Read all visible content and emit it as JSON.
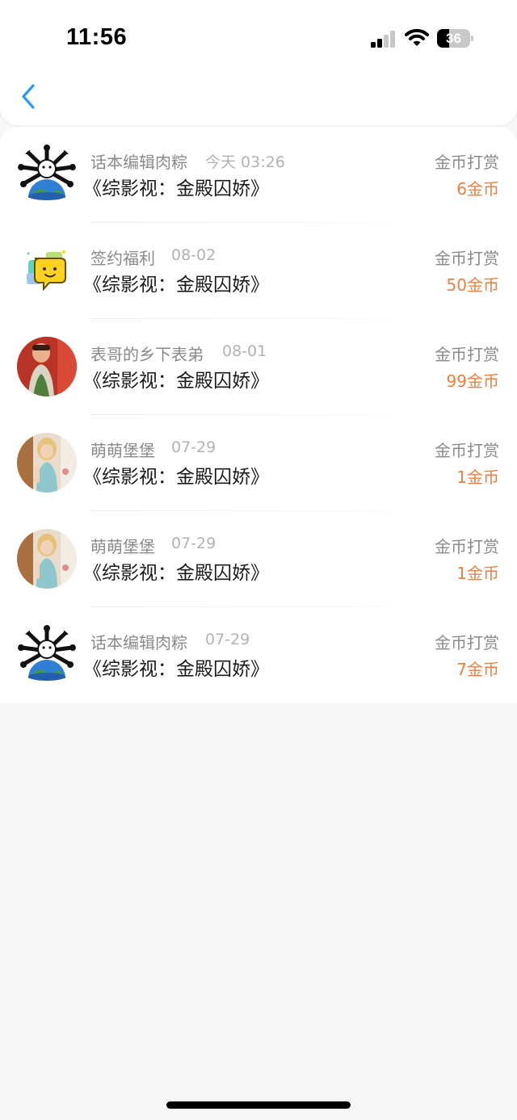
{
  "status_bar": {
    "time": "11:56",
    "battery": "36",
    "battery_fraction": 0.36,
    "signal_bars": 2,
    "icons": [
      "signal-icon",
      "wifi-icon",
      "battery-icon"
    ]
  },
  "nav": {
    "back_icon": "chevron-left-icon",
    "accent": "#2f9bf0"
  },
  "colors": {
    "amount": "#ec7f3f",
    "meta": "#8a8a8a",
    "date": "#b2b2b2"
  },
  "records": [
    {
      "sender": "话本编辑肉粽",
      "date": "今天 03:26",
      "book": "《综影视：金殿囚娇》",
      "type": "金币打赏",
      "amount": "6金币",
      "avatar": "earth-cartoon-avatar"
    },
    {
      "sender": "签约福利",
      "date": "08-02",
      "book": "《综影视：金殿囚娇》",
      "type": "金币打赏",
      "amount": "50金币",
      "avatar": "yellow-chat-bubble-avatar"
    },
    {
      "sender": "表哥的乡下表弟",
      "date": "08-01",
      "book": "《综影视：金殿囚娇》",
      "type": "金币打赏",
      "amount": "99金币",
      "avatar": "red-photo-avatar"
    },
    {
      "sender": "萌萌堡堡",
      "date": "07-29",
      "book": "《综影视：金殿囚娇》",
      "type": "金币打赏",
      "amount": "1金币",
      "avatar": "doll-photo-avatar"
    },
    {
      "sender": "萌萌堡堡",
      "date": "07-29",
      "book": "《综影视：金殿囚娇》",
      "type": "金币打赏",
      "amount": "1金币",
      "avatar": "doll-photo-avatar"
    },
    {
      "sender": "话本编辑肉粽",
      "date": "07-29",
      "book": "《综影视：金殿囚娇》",
      "type": "金币打赏",
      "amount": "7金币",
      "avatar": "earth-cartoon-avatar"
    }
  ]
}
